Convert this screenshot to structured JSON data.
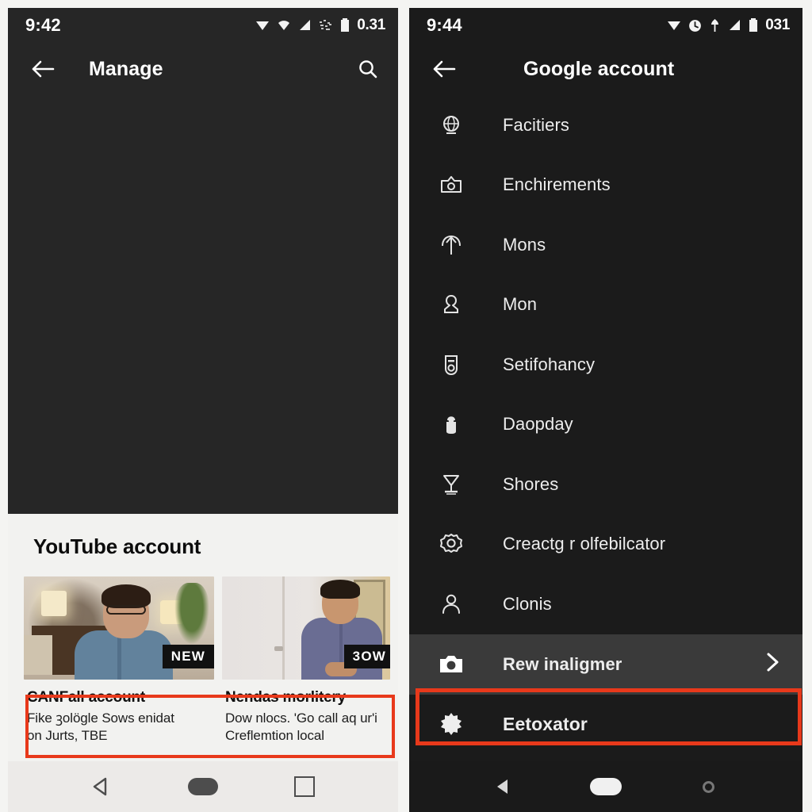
{
  "colors": {
    "highlight_red": "#e8391b",
    "dark_panel": "#262626",
    "dark_menu": "#1b1b1b",
    "light_section": "#f2f2f0",
    "row_highlight": "#3a3a3a"
  },
  "left_panel": {
    "status": {
      "time": "9:42",
      "battery_text": "0.31",
      "icons": [
        "location-icon",
        "wifi-icon",
        "signal-icon",
        "noise-icon",
        "battery-icon"
      ]
    },
    "appbar": {
      "back_icon": "back-arrow-icon",
      "title": "Manage",
      "search_icon": "search-icon"
    },
    "section": {
      "title": "YouTube account"
    },
    "videos": [
      {
        "badge": "NEW",
        "title": "CANFall account",
        "subtitle": "Fike ꝫolögle Sows enidat\non Jurts, TBE"
      },
      {
        "badge": "3OW",
        "title": "Nendas morlitery",
        "subtitle": "Dow nlocs. 'Go call aq ur'i\nCreflemtion local"
      }
    ],
    "navbar": {
      "back": "nav-back-icon",
      "home": "nav-home-icon",
      "recents": "nav-recents-icon"
    }
  },
  "right_panel": {
    "status": {
      "time": "9:44",
      "battery_text": "031",
      "icons": [
        "location-icon",
        "clock-icon",
        "cast-icon",
        "signal-icon",
        "battery-icon"
      ]
    },
    "appbar": {
      "back_icon": "back-arrow-icon",
      "title": "Google account"
    },
    "menu_items": [
      {
        "icon": "globe-icon",
        "label": "Facitiers"
      },
      {
        "icon": "gallery-icon",
        "label": "Enchirements"
      },
      {
        "icon": "upload-icon",
        "label": "Mons"
      },
      {
        "icon": "group-icon",
        "label": "Mon"
      },
      {
        "icon": "device-icon",
        "label": "Setifohancy"
      },
      {
        "icon": "lock-icon",
        "label": "Daopday"
      },
      {
        "icon": "trophy-icon",
        "label": "Shores"
      },
      {
        "icon": "settings-icon",
        "label": "Creactg r olfebilcator"
      },
      {
        "icon": "person-icon",
        "label": "Clonis"
      }
    ],
    "highlight_row": {
      "icon": "camera-icon",
      "label": "Rew inaligmer",
      "chevron": "chevron-right-icon"
    },
    "boxed_row": {
      "icon": "gear-flower-icon",
      "label": "Eetoxator"
    },
    "navbar": {
      "back": "nav-back-icon",
      "home": "nav-home-icon",
      "recents": "nav-recents-icon"
    }
  }
}
